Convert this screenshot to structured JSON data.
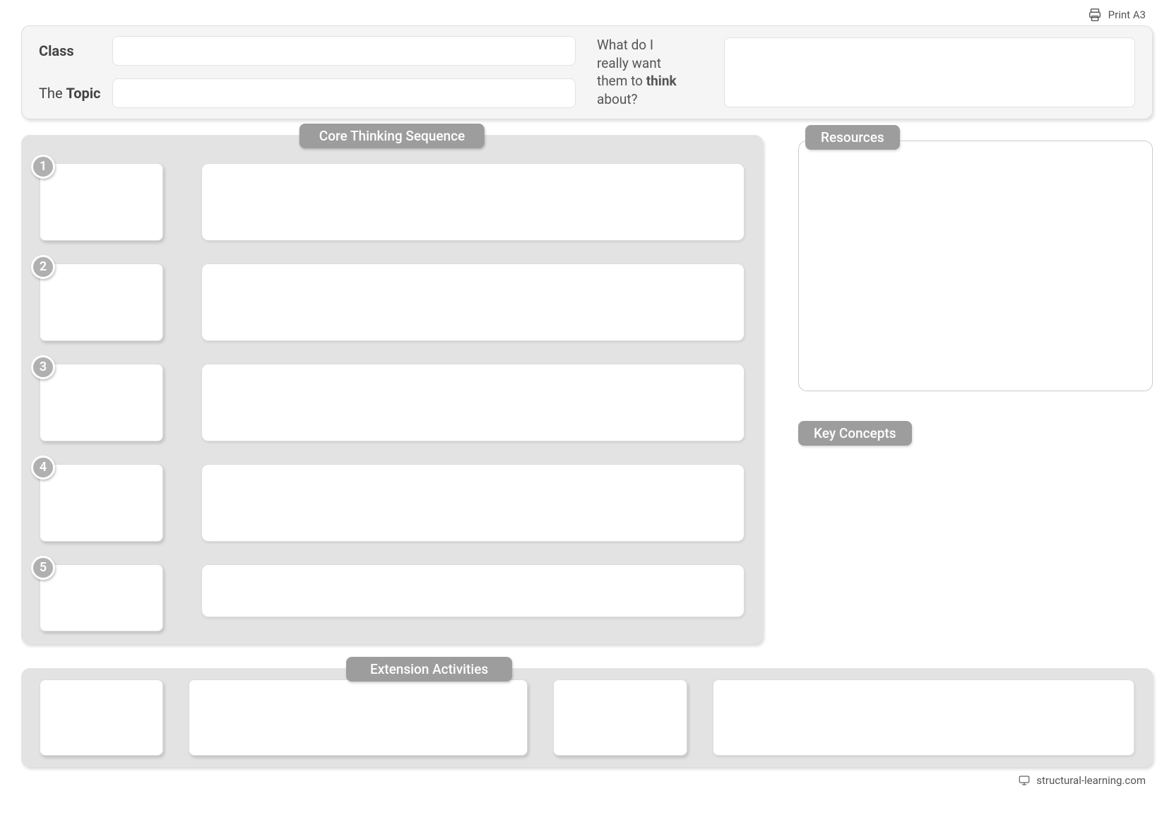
{
  "print_label": "Print A3",
  "header": {
    "class_label": "Class",
    "topic_prefix": "The ",
    "topic_bold": "Topic",
    "prompt_line1": "What do I",
    "prompt_line2": "really want",
    "prompt_line3a": "them to ",
    "prompt_line3b": "think",
    "prompt_line4": "about?"
  },
  "sections": {
    "core_thinking": "Core Thinking Sequence",
    "resources": "Resources",
    "key_concepts": "Key Concepts",
    "extension": "Extension Activities"
  },
  "sequence_numbers": [
    "1",
    "2",
    "3",
    "4",
    "5"
  ],
  "footer_site": "structural-learning.com"
}
